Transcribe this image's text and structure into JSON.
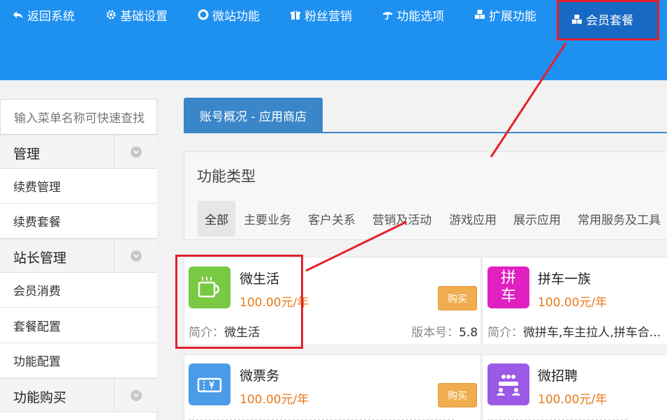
{
  "nav": {
    "items": [
      {
        "label": "返回系统",
        "icon": "back-arrow-icon"
      },
      {
        "label": "基础设置",
        "icon": "gear-icon"
      },
      {
        "label": "微站功能",
        "icon": "lifebuoy-icon"
      },
      {
        "label": "粉丝营销",
        "icon": "gift-icon"
      },
      {
        "label": "功能选项",
        "icon": "umbrella-icon"
      },
      {
        "label": "扩展功能",
        "icon": "cubes-icon"
      },
      {
        "label": "会员套餐",
        "icon": "cubes-icon"
      }
    ],
    "highlight_color": "#e4212c",
    "bar_color": "#1e90f0"
  },
  "sidebar": {
    "search_placeholder": "输入菜单名称可快速查找",
    "groups": [
      {
        "label": "管理",
        "items": [
          "续费管理",
          "续费套餐"
        ]
      },
      {
        "label": "站长管理",
        "items": [
          "会员消费",
          "套餐配置",
          "功能配置"
        ]
      },
      {
        "label": "功能购买",
        "items": []
      }
    ]
  },
  "main": {
    "tab": "账号概况 - 应用商店",
    "filter_title": "功能类型",
    "categories": [
      "全部",
      "主要业务",
      "客户关系",
      "营销及活动",
      "游戏应用",
      "展示应用",
      "常用服务及工具"
    ],
    "apps": [
      {
        "name": "微生活",
        "price": "100.00元/年",
        "buy": "购买",
        "desc_label": "简介：",
        "desc": "微生活",
        "ver_label": "版本号：",
        "ver": "5.8",
        "icon": "cup-icon",
        "color": "#7ac943"
      },
      {
        "name": "拼车一族",
        "price": "100.00元/年",
        "desc_label": "简介：",
        "desc": "微拼车,车主拉人,拼车合...",
        "icon_text": "拼车",
        "icon": "carpool-icon",
        "color": "#e020c0"
      },
      {
        "name": "微票务",
        "price": "100.00元/年",
        "buy": "购买",
        "icon": "ticket-icon",
        "color": "#4a9be8"
      },
      {
        "name": "微招聘",
        "price": "100.00元/年",
        "icon": "meeting-icon",
        "color": "#9b59e6"
      }
    ]
  }
}
